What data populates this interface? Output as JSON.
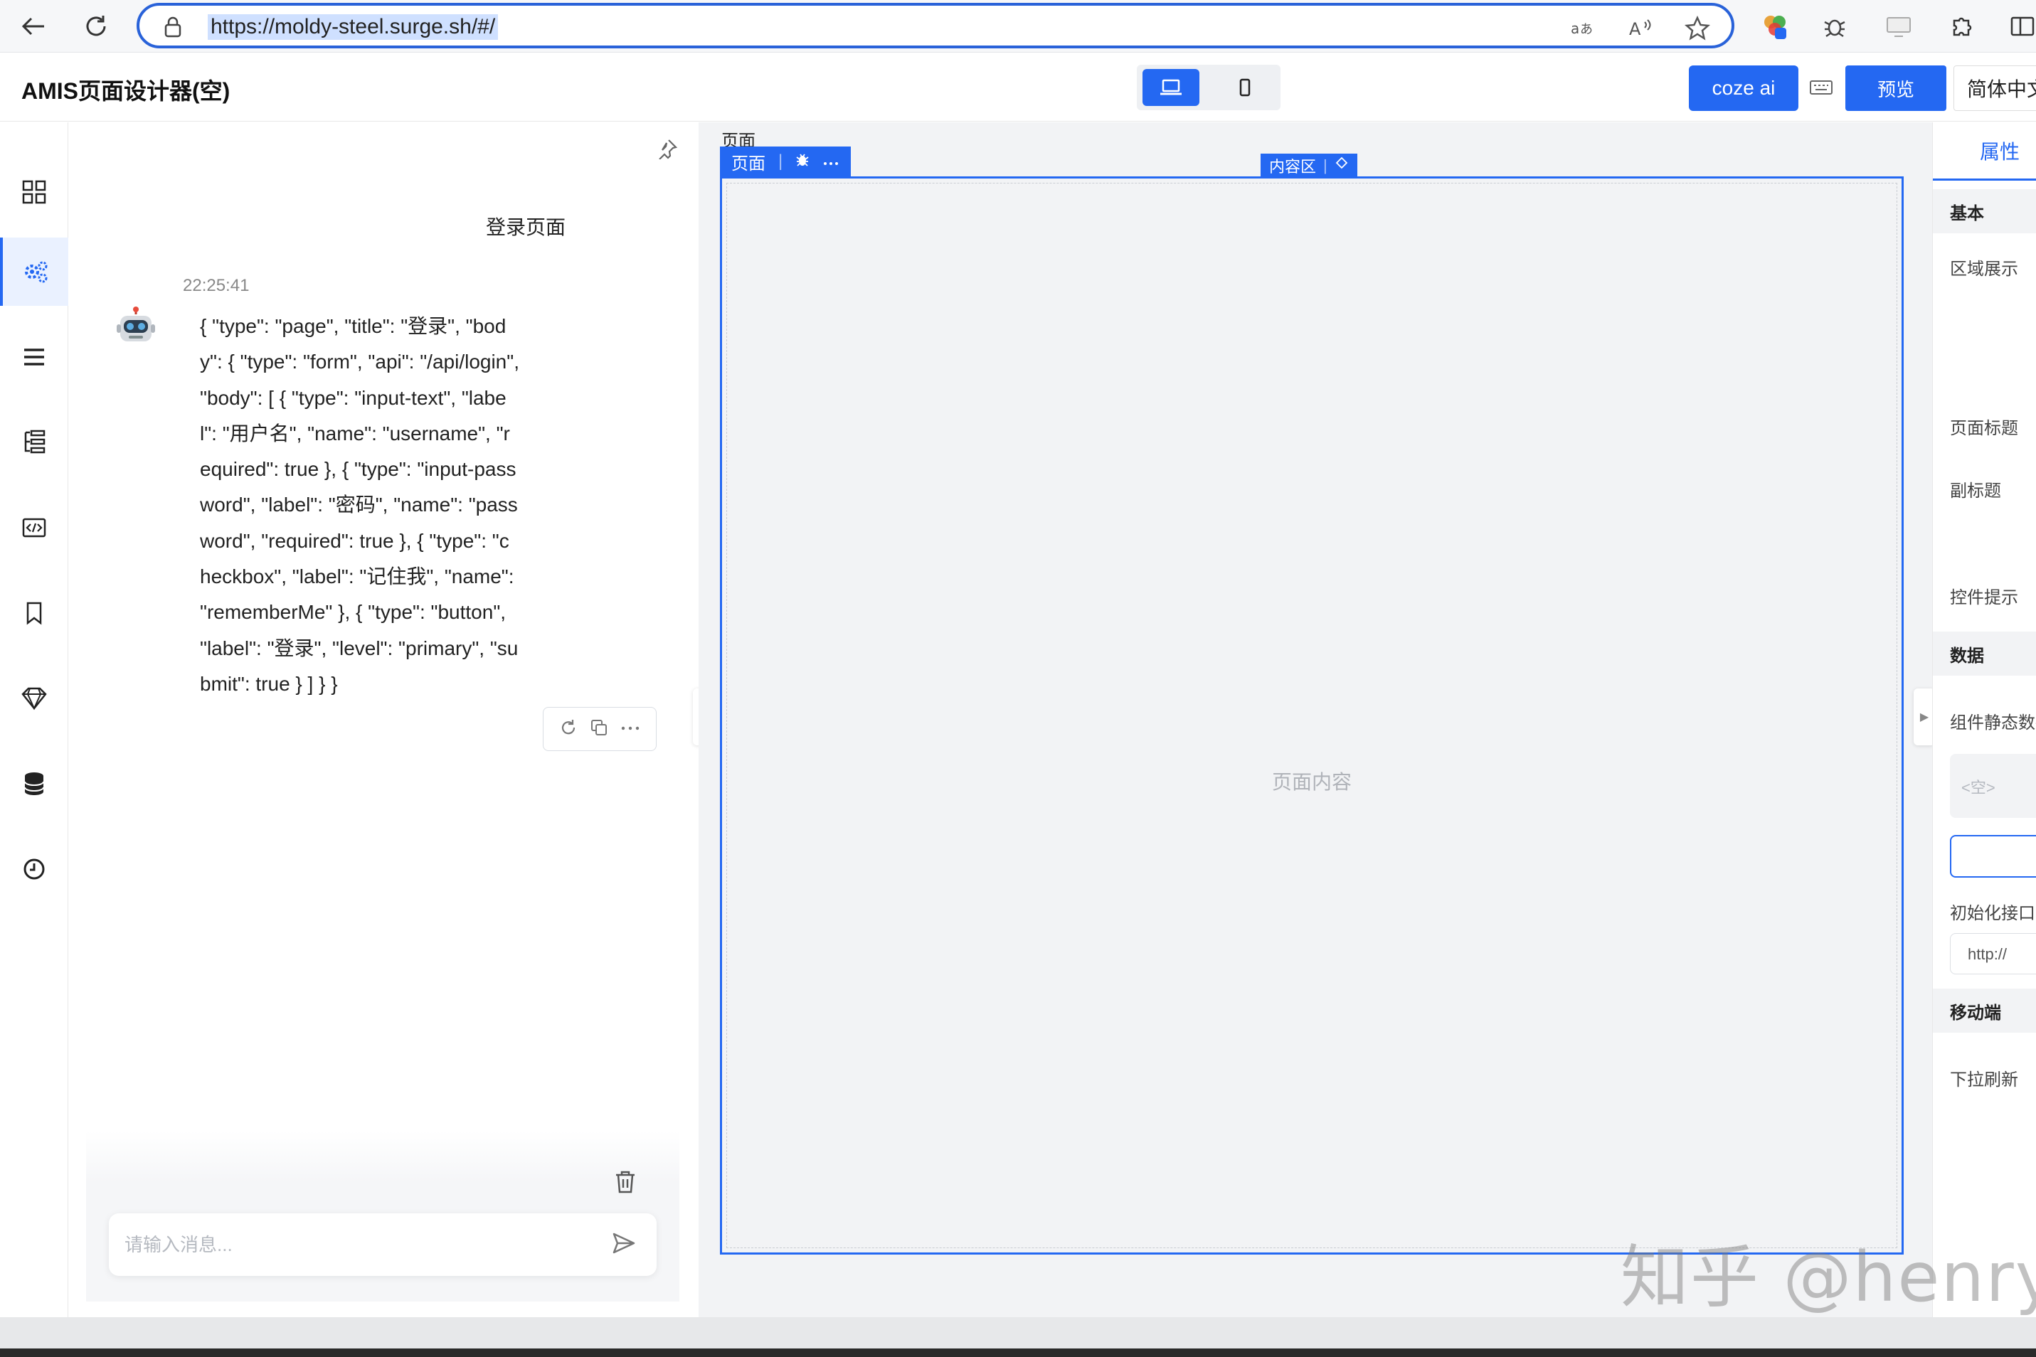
{
  "browser": {
    "url": "https://moldy-steel.surge.sh/#/"
  },
  "app": {
    "title": "AMIS页面设计器(空)",
    "coze_label": "coze ai",
    "preview_label": "预览",
    "language_label": "简体中文"
  },
  "chat": {
    "user_message": "登录页面",
    "timestamp": "22:25:41",
    "bot_message": "{ \"type\": \"page\", \"title\": \"登录\", \"body\": { \"type\": \"form\", \"api\": \"/api/login\", \"body\": [ { \"type\": \"input-text\", \"label\": \"用户名\", \"name\": \"username\", \"required\": true }, { \"type\": \"input-password\", \"label\": \"密码\", \"name\": \"password\", \"required\": true }, { \"type\": \"checkbox\", \"label\": \"记住我\", \"name\": \"rememberMe\" }, { \"type\": \"button\", \"label\": \"登录\", \"level\": \"primary\", \"submit\": true } ] } }",
    "input_placeholder": "请输入消息..."
  },
  "canvas": {
    "breadcrumb": "页面",
    "page_tag": "页面",
    "content_tag": "内容区",
    "placeholder": "页面内容"
  },
  "props": {
    "tab": "属性",
    "sections": {
      "basic": "基本",
      "data": "数据",
      "mobile": "移动端"
    },
    "labels": {
      "region": "区域展示",
      "page_title": "页面标题",
      "subtitle": "副标题",
      "hint": "控件提示",
      "static_data": "组件静态数据",
      "empty": "<空>",
      "init_api": "初始化接口",
      "api_placeholder": "http://",
      "pull_refresh": "下拉刷新"
    }
  },
  "watermark": "知乎 @henry",
  "colors": {
    "primary": "#2468f2",
    "canvas_bg": "#f2f3f5"
  }
}
